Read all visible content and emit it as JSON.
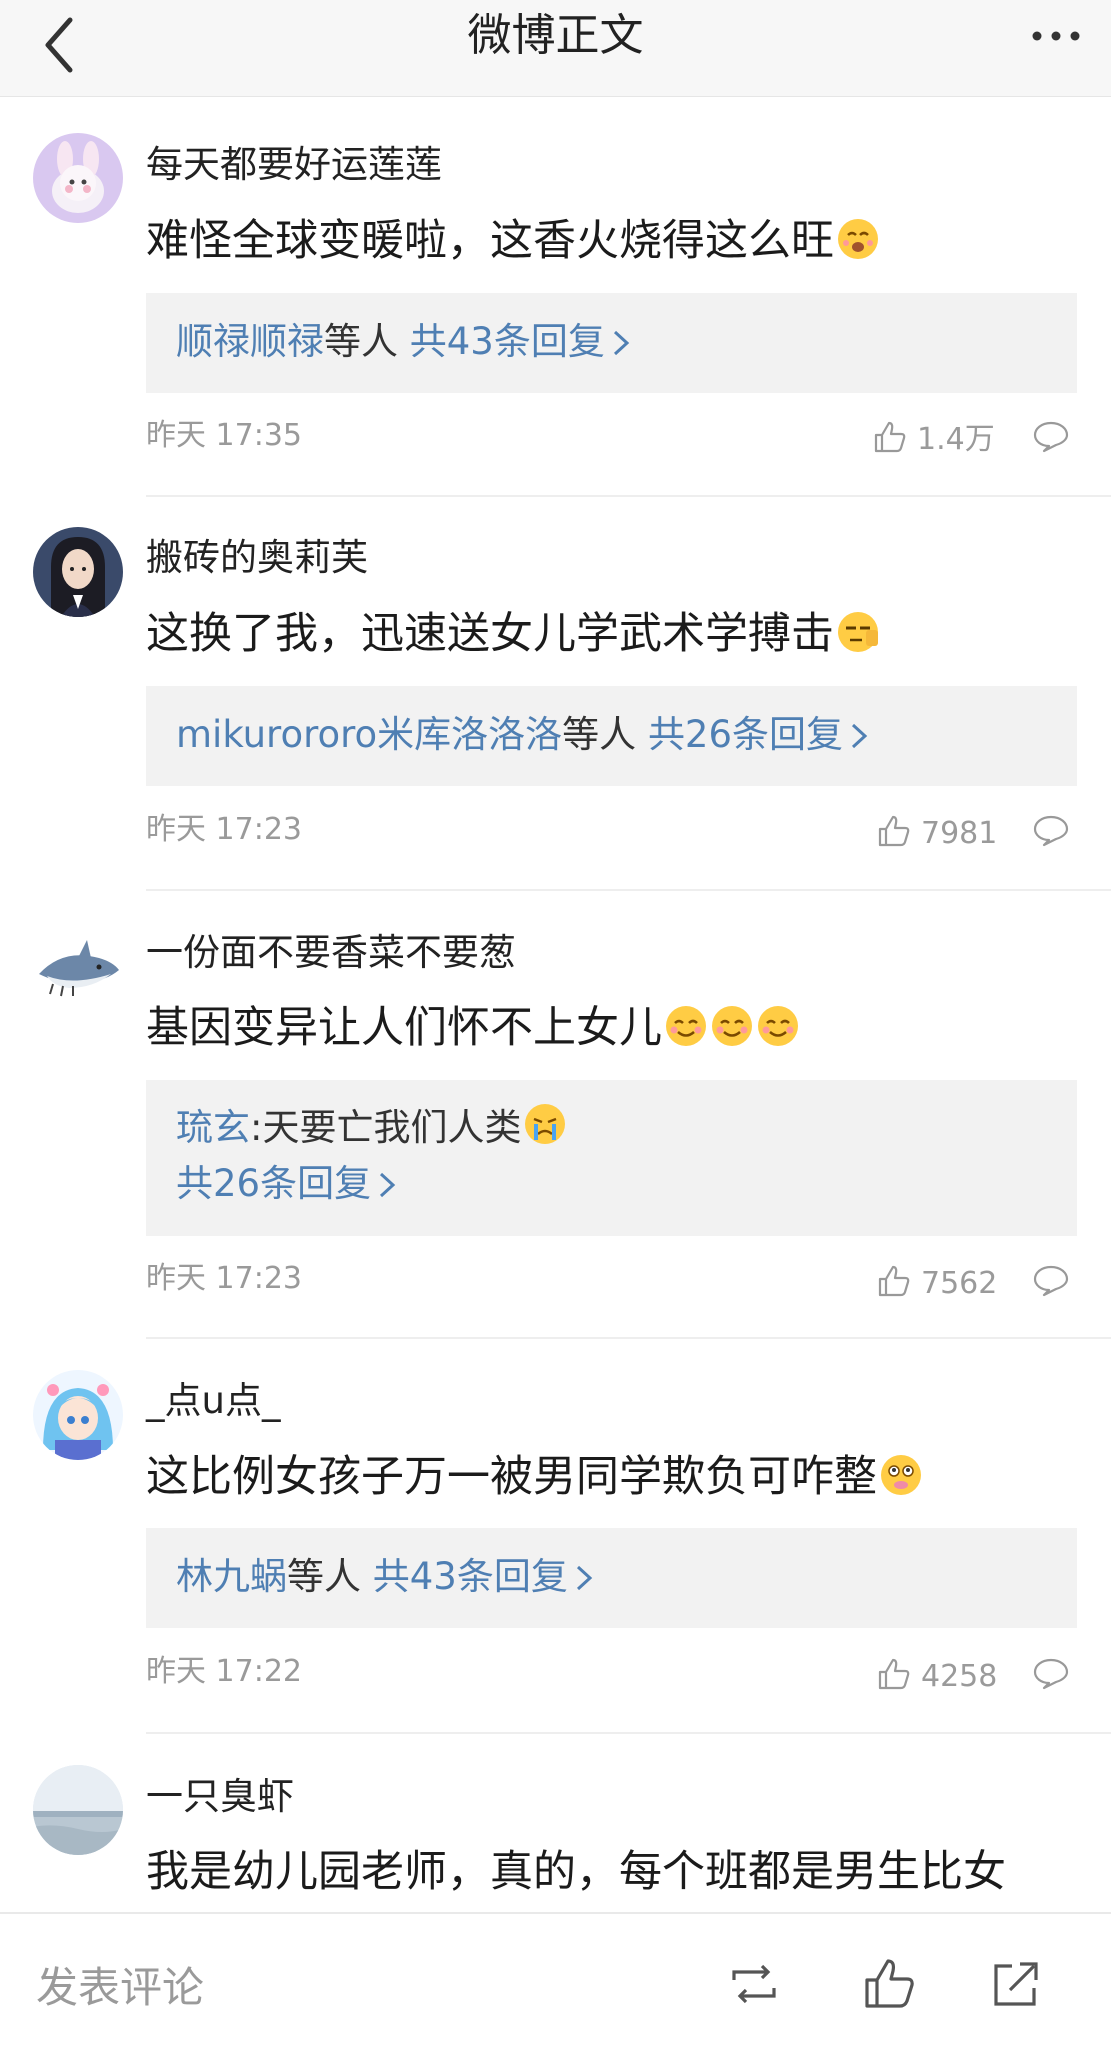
{
  "header": {
    "title": "微博正文"
  },
  "comments": [
    {
      "username": "每天都要好运莲莲",
      "text": "难怪全球变暖啦，这香火烧得这么旺",
      "replies": {
        "users": "顺禄顺禄",
        "mid": "等人",
        "count_text": "共43条回复"
      },
      "time": "昨天 17:35",
      "likes": "1.4万"
    },
    {
      "username": "搬砖的奥莉芙",
      "text": "这换了我，迅速送女儿学武术学搏击",
      "replies": {
        "users": "mikurororo米库洛洛洛",
        "mid": "等人",
        "count_text": "共26条回复"
      },
      "time": "昨天 17:23",
      "likes": "7981"
    },
    {
      "username": "一份面不要香菜不要葱",
      "text": "基因变异让人们怀不上女儿",
      "reply_preview": {
        "user": "琉玄",
        "sep": ":",
        "text": "天要亡我们人类",
        "count_text": "共26条回复"
      },
      "time": "昨天 17:23",
      "likes": "7562"
    },
    {
      "username": "_点u点_",
      "text": "这比例女孩子万一被男同学欺负可咋整",
      "replies": {
        "users": "林九蜗",
        "mid": "等人",
        "count_text": "共43条回复"
      },
      "time": "昨天 17:22",
      "likes": "4258"
    },
    {
      "username": "一只臭虾",
      "text": "我是幼儿园老师，真的，每个班都是男生比女"
    }
  ],
  "bottom_bar": {
    "input_placeholder": "发表评论"
  },
  "colors": {
    "link": "#4f7fb3",
    "meta": "#9a9a9a",
    "reply_bg": "#f2f2f2"
  },
  "icons": [
    "back-arrow-icon",
    "more-dots-icon",
    "like-icon",
    "comment-icon",
    "repost-icon",
    "share-icon",
    "emoji-icon"
  ]
}
